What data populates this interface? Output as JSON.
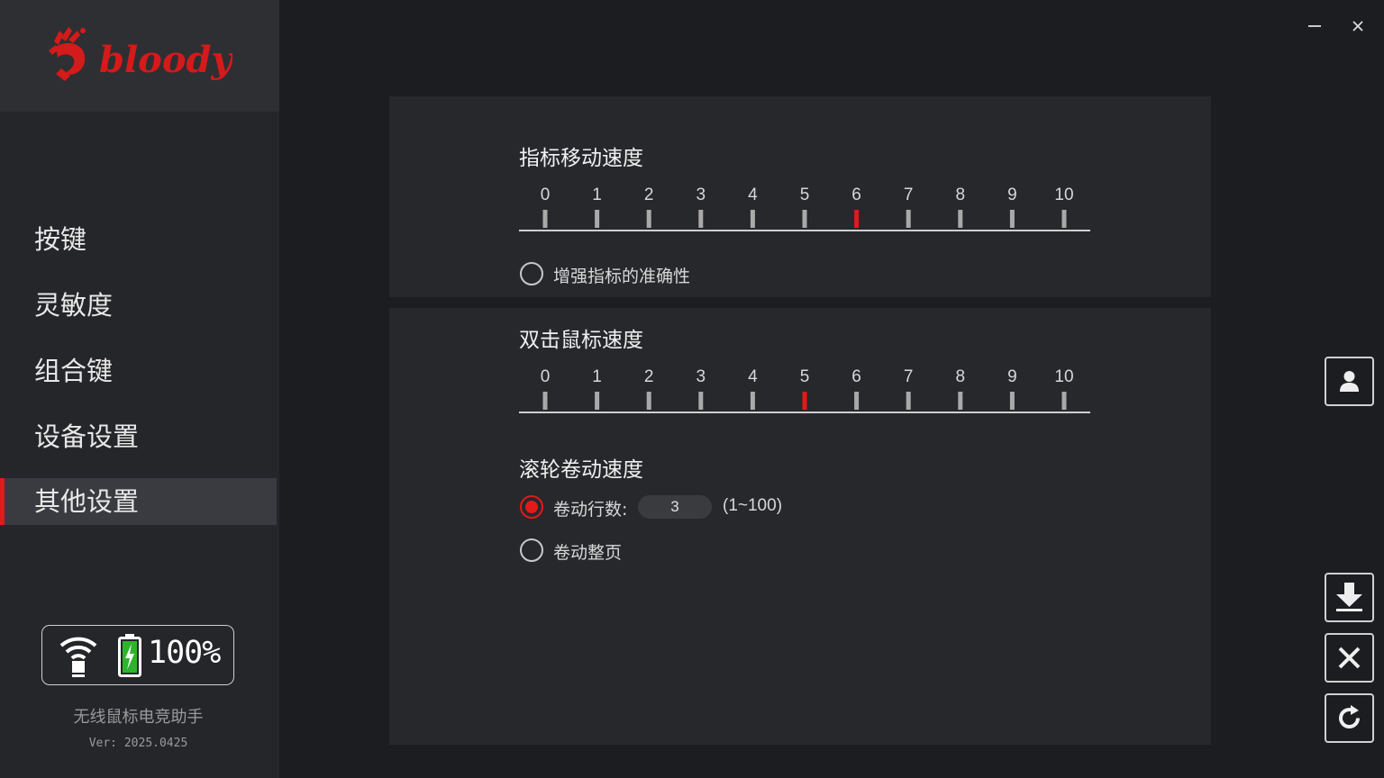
{
  "brand": {
    "logo_text": "bloody"
  },
  "window": {
    "minimize_icon": "minimize-icon",
    "close_icon": "close-icon"
  },
  "sidebar": {
    "items": [
      {
        "label": "按键",
        "active": false
      },
      {
        "label": "灵敏度",
        "active": false
      },
      {
        "label": "组合键",
        "active": false
      },
      {
        "label": "设备设置",
        "active": false
      },
      {
        "label": "其他设置",
        "active": true
      }
    ],
    "status": {
      "connection_icon": "wireless-icon",
      "battery_icon": "battery-charging-icon",
      "battery_percent": "100%",
      "battery_level": 1.0
    },
    "app_name": "无线鼠标电竞助手",
    "version": "Ver: 2025.0425"
  },
  "pointer_speed": {
    "title": "指标移动速度",
    "ticks": [
      "0",
      "1",
      "2",
      "3",
      "4",
      "5",
      "6",
      "7",
      "8",
      "9",
      "10"
    ],
    "value": 6,
    "enhance_option": {
      "label": "增强指标的准确性",
      "checked": false
    }
  },
  "double_click_speed": {
    "title": "双击鼠标速度",
    "ticks": [
      "0",
      "1",
      "2",
      "3",
      "4",
      "5",
      "6",
      "7",
      "8",
      "9",
      "10"
    ],
    "value": 5
  },
  "scroll_speed": {
    "title": "滚轮卷动速度",
    "lines_option": {
      "label": "卷动行数:",
      "checked": true,
      "value": "3",
      "range": "(1~100)"
    },
    "page_option": {
      "label": "卷动整页",
      "checked": false
    }
  },
  "side_buttons": [
    "profile-icon",
    "download-icon",
    "close-icon",
    "reset-icon"
  ],
  "colors": {
    "accent": "#e21a1a",
    "background": "#1c1d20",
    "sidebar": "#25262a",
    "panel": "#27282c"
  }
}
